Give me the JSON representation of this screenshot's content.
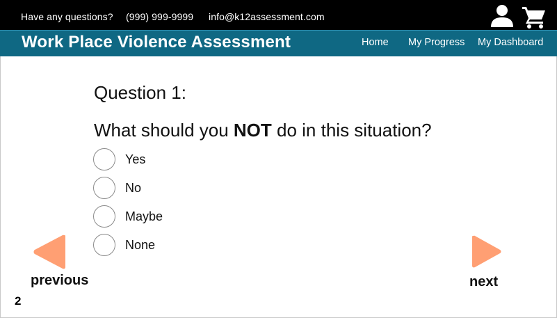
{
  "header": {
    "contact_question": "Have any questions?",
    "phone": "(999) 999-9999",
    "email": "info@k12assessment.com",
    "icons": [
      "user-icon",
      "shopping-cart-icon"
    ]
  },
  "nav": {
    "title": "Work Place Violence Assessment",
    "links": [
      "Home",
      "My Progress",
      "My Dashboard"
    ]
  },
  "question": {
    "number_label": "Question 1:",
    "text_before": "What should you ",
    "text_emphasis": "NOT",
    "text_after": " do in this situation?",
    "options": [
      "Yes",
      "No",
      "Maybe",
      "None"
    ]
  },
  "footer": {
    "previous_label": "previous",
    "next_label": "next",
    "page_number": "2"
  },
  "colors": {
    "topbar": "#000000",
    "navbar": "#0f6883",
    "arrow": "#ff9f73"
  }
}
